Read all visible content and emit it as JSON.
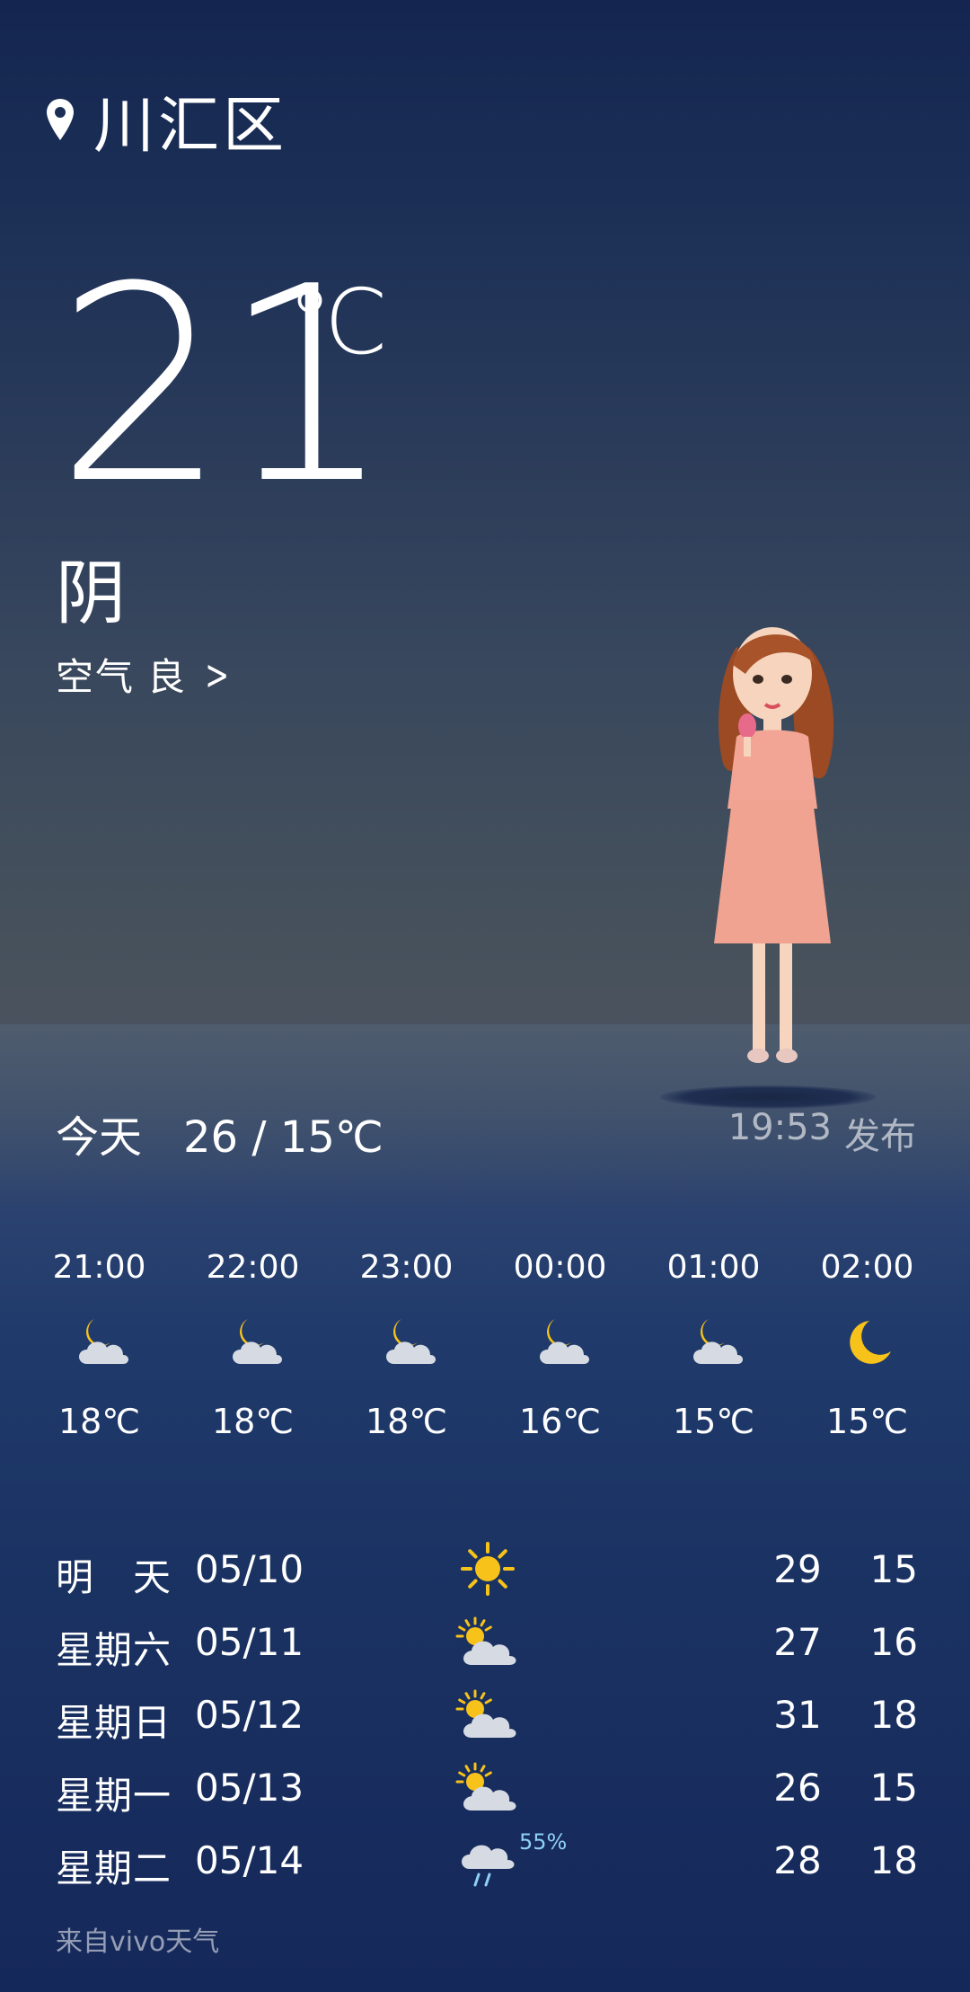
{
  "location": {
    "name": "川汇区",
    "icon": "location-pin-icon"
  },
  "current": {
    "temperature": "21",
    "unit": "℃",
    "condition": "阴"
  },
  "air_quality": {
    "label": "空气",
    "value": "良",
    "chevron": ">"
  },
  "today": {
    "label": "今天",
    "range": "26 / 15℃"
  },
  "published": {
    "time": "19:53",
    "label": "发布"
  },
  "hourly": [
    {
      "time": "21:00",
      "icon": "cloudy-night-icon",
      "temp": "18℃"
    },
    {
      "time": "22:00",
      "icon": "cloudy-night-icon",
      "temp": "18℃"
    },
    {
      "time": "23:00",
      "icon": "cloudy-night-icon",
      "temp": "18℃"
    },
    {
      "time": "00:00",
      "icon": "cloudy-night-icon",
      "temp": "16℃"
    },
    {
      "time": "01:00",
      "icon": "cloudy-night-icon",
      "temp": "15℃"
    },
    {
      "time": "02:00",
      "icon": "clear-night-icon",
      "temp": "15℃"
    }
  ],
  "daily": [
    {
      "day": "明　天",
      "date": "05/10",
      "icon": "sunny-icon",
      "high": "29",
      "low": "15",
      "precip": ""
    },
    {
      "day": "星期六",
      "date": "05/11",
      "icon": "partly-cloudy-icon",
      "high": "27",
      "low": "16",
      "precip": ""
    },
    {
      "day": "星期日",
      "date": "05/12",
      "icon": "partly-cloudy-icon",
      "high": "31",
      "low": "18",
      "precip": ""
    },
    {
      "day": "星期一",
      "date": "05/13",
      "icon": "partly-cloudy-icon",
      "high": "26",
      "low": "15",
      "precip": ""
    },
    {
      "day": "星期二",
      "date": "05/14",
      "icon": "rain-icon",
      "high": "28",
      "low": "18",
      "precip": "55%"
    }
  ],
  "source": "来自vivo天气",
  "colors": {
    "sun": "#f7c21a",
    "cloud": "#d6dbe3",
    "rain": "#8fd0f5"
  }
}
